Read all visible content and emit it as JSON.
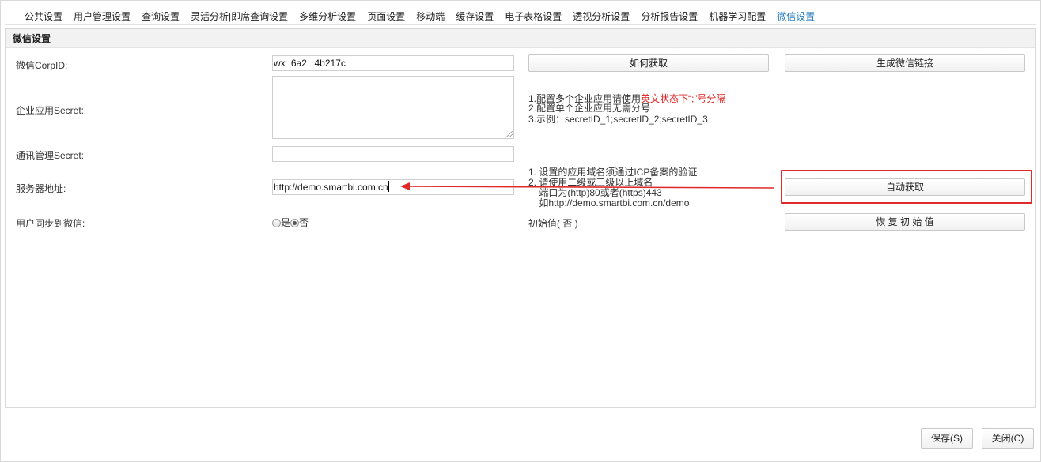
{
  "tabs": [
    {
      "label": "公共设置",
      "active": false
    },
    {
      "label": "用户管理设置",
      "active": false
    },
    {
      "label": "查询设置",
      "active": false
    },
    {
      "label": "灵活分析|即席查询设置",
      "active": false
    },
    {
      "label": "多维分析设置",
      "active": false
    },
    {
      "label": "页面设置",
      "active": false
    },
    {
      "label": "移动端",
      "active": false
    },
    {
      "label": "缓存设置",
      "active": false
    },
    {
      "label": "电子表格设置",
      "active": false
    },
    {
      "label": "透视分析设置",
      "active": false
    },
    {
      "label": "分析报告设置",
      "active": false
    },
    {
      "label": "机器学习配置",
      "active": false
    },
    {
      "label": "微信设置",
      "active": true
    }
  ],
  "panel": {
    "title": "微信设置",
    "corpid": {
      "label": "微信CorpID:",
      "value": "wx   6a2    4b217c",
      "how_button": "如何获取",
      "gen_button": "生成微信链接"
    },
    "secret": {
      "label": "企业应用Secret:",
      "value": "",
      "hint_1_prefix": "1.配置多个企业应用请使用",
      "hint_1_red": "英文状态下“;”号分隔",
      "hint_2": "2.配置单个企业应用无需分号",
      "hint_3": "3.示例：secretID_1;secretID_2;secretID_3"
    },
    "contact_secret": {
      "label": "通讯管理Secret:",
      "value": ""
    },
    "server": {
      "label": "服务器地址:",
      "value": "http://demo.smartbi.com.cn",
      "hint_1": "1. 设置的应用域名须通过ICP备案的验证",
      "hint_2": "2. 请使用二级或三级以上域名",
      "hint_3": "    端口为(http)80或者(https)443",
      "hint_4": "    如http://demo.smartbi.com.cn/demo",
      "auto_button": "自动获取"
    },
    "sync": {
      "label": "用户同步到微信:",
      "option_yes": "是",
      "option_no": "否",
      "selected": "否",
      "default_text": "初始值( 否 )",
      "reset_button": "恢 复 初 始 值"
    }
  },
  "footer": {
    "save_button": "保存(S)",
    "close_button": "关闭(C)"
  },
  "colors": {
    "accent": "#2b7fc2",
    "annotation_red": "#e02a2a"
  }
}
